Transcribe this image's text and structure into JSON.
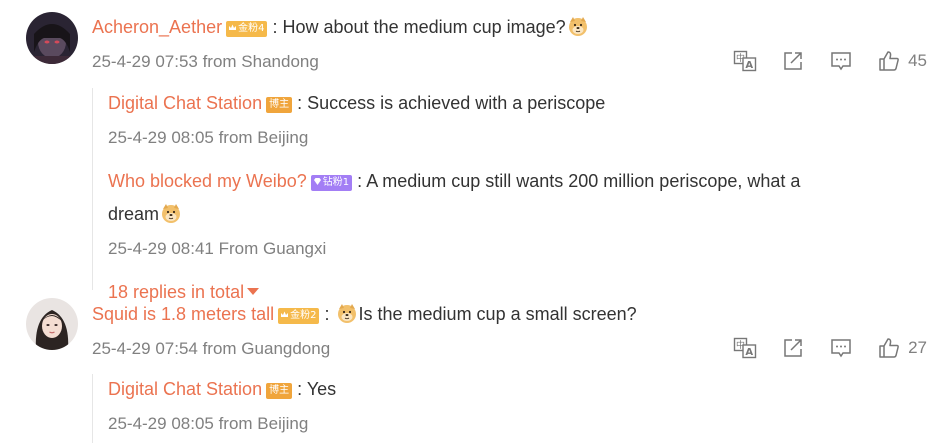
{
  "comments": [
    {
      "user": "Acheron_Aether",
      "badge": "金粉4",
      "separator": ":",
      "text": "How about the medium cup image?",
      "meta": "25-4-29 07:53 from Shandong",
      "likes": "45",
      "replies": [
        {
          "user": "Digital Chat Station",
          "badge": "博主",
          "separator": ":",
          "text": "Success is achieved with a periscope",
          "meta": "25-4-29 08:05 from Beijing"
        },
        {
          "user": "Who blocked my Weibo?",
          "badge": "钻粉1",
          "separator": ":",
          "text": "A medium cup still wants 200 million periscope, what a",
          "text_line2": "dream",
          "meta": "25-4-29 08:41 From Guangxi"
        }
      ],
      "more_replies": "18 replies in total"
    },
    {
      "user": "Squid is 1.8 meters tall",
      "badge": "金粉2",
      "separator": ":",
      "text": "Is the medium cup a small screen?",
      "meta": "25-4-29 07:54 from Guangdong",
      "likes": "27",
      "replies": [
        {
          "user": "Digital Chat Station",
          "badge": "博主",
          "separator": ":",
          "text": "Yes",
          "meta": "25-4-29 08:05 from Beijing"
        }
      ]
    }
  ],
  "icons": {
    "translate": "translate-icon",
    "share": "share-icon",
    "comment": "comment-icon",
    "like": "thumbs-up-icon",
    "emoji": "doge-emoji-icon"
  },
  "colors": {
    "username": "#eb7350",
    "text": "#333333",
    "meta": "#808080",
    "gold_badge": "#f5b94a",
    "host_badge": "#f0a53c",
    "diamond_badge": "#a37ef5",
    "divider": "#e6e6e6"
  }
}
